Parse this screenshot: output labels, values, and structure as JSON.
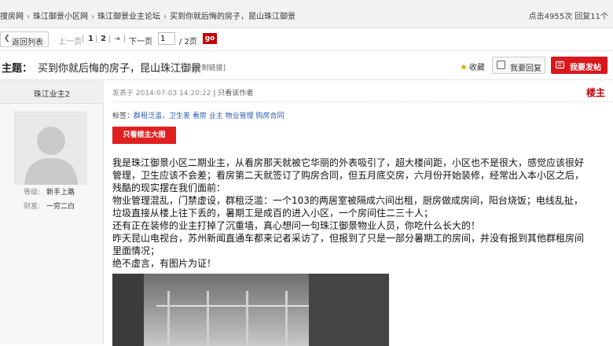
{
  "breadcrumb": {
    "items": [
      "搜房网",
      "珠江御景小区网",
      "珠江御景业主论坛",
      "买到你就后悔的房子，昆山珠江御景"
    ],
    "separator": "›"
  },
  "stats": {
    "clicks_label": "点击",
    "clicks": "4955",
    "clicks_unit": "次",
    "replies_label": "回复",
    "replies": "11",
    "replies_unit": "个"
  },
  "pager": {
    "back_label": "返回列表",
    "prev_label": "上一页",
    "page1": "1",
    "page2": "2",
    "next_label": "下一页",
    "current_value": "1",
    "total": "/ 2页",
    "go_label": "go"
  },
  "thread": {
    "subject_label": "主题：",
    "subject": "买到你就后悔的房子，昆山珠江御景",
    "copy_link": "[复制链接]",
    "collect_label": "收藏",
    "reply_label": "我要回复",
    "post_label": "我要发帖"
  },
  "author": {
    "name": "珠江业主2",
    "level_label": "等级:",
    "level": "新手上路",
    "wealth_label": "财富:",
    "wealth": "一穷二白"
  },
  "post": {
    "posted_at": "发表于 2014-07-03 14:20:22",
    "only_author": "| 只看该作者",
    "floor": "楼主",
    "tags_label": "标签：",
    "tags": "群租泛滥，卫生差 看房 业主 物业管理 购房合同",
    "only_owner_btn": "只看楼主大图",
    "lines": [
      "我是珠江御景小区二期业主，从看房那天就被它华丽的外表吸引了，超大楼间距，小区也不是很大，感觉应该很好",
      "管理，卫生应该不会差；看房第二天就签订了购房合同，但五月底交房，六月份开始装修，经常出入本小区之后，",
      "残酷的现实摆在我们面前：",
      "物业管理混乱，门禁虚设，群租泛滥：一个103的两居室被隔成六间出租，厨房做成房间，阳台烧饭；电线乱扯，",
      "垃圾直接从楼上往下丢的，暑期工是成百的进入小区，一个房间住二三十人；",
      "还有正在装修的业主打掉了沉重墙，真心想问一句珠江御景物业人员，你吃什么长大的！",
      "昨天昆山电视台，苏州新闻直通车都来记者采访了，但报到了只是一部分暑期工的房间，并没有报到其他群租房间",
      "里面情况；",
      "绝不虚言，有图片为证！"
    ]
  },
  "colors": {
    "accent_red": "#d9171c",
    "floor_red": "#c30000",
    "tag_blue": "#2a5db0",
    "star": "#e8a400"
  },
  "icons": [
    "back-arrow-icon",
    "first-page-icon",
    "last-page-icon",
    "star-icon",
    "reply-icon",
    "post-icon",
    "default-avatar-icon"
  ]
}
